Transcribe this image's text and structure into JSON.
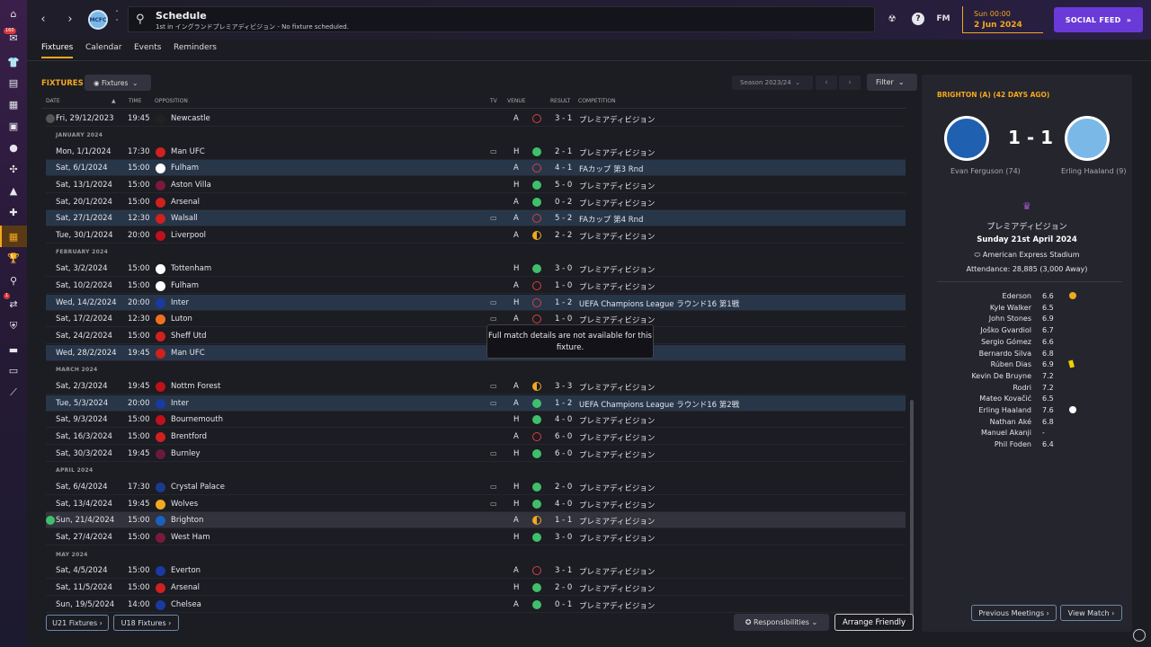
{
  "header": {
    "title": "Schedule",
    "subtitle": "1st in イングランドプレミアディビジョン - No fixture scheduled.",
    "fm_label": "FM",
    "day_time": "Sun 00:00",
    "date": "2 Jun 2024",
    "social_feed": "SOCIAL FEED",
    "badge_count": "160"
  },
  "tabs": [
    "Fixtures",
    "Calendar",
    "Events",
    "Reminders"
  ],
  "fixtures": {
    "title": "FIXTURES",
    "view_select": "Fixtures",
    "season": "Season 2023/24",
    "filter": "Filter",
    "columns": {
      "date": "DATE",
      "time": "TIME",
      "opposition": "OPPOSITION",
      "tv": "TV",
      "venue": "VENUE",
      "result": "RESULT",
      "competition": "COMPETITION"
    },
    "months": [
      "JANUARY 2024",
      "FEBRUARY 2024",
      "MARCH 2024",
      "APRIL 2024",
      "MAY 2024"
    ],
    "rows": [
      {
        "date": "Fri, 29/12/2023",
        "time": "19:45",
        "opp": "Newcastle",
        "venue": "A",
        "result": "3 - 1",
        "comp": "プレミアディビジョン"
      },
      {
        "date": "Mon, 1/1/2024",
        "time": "17:30",
        "opp": "Man UFC",
        "venue": "H",
        "result": "2 - 1",
        "comp": "プレミアディビジョン"
      },
      {
        "date": "Sat, 6/1/2024",
        "time": "15:00",
        "opp": "Fulham",
        "venue": "A",
        "result": "4 - 1",
        "comp": "FAカップ 第3 Rnd"
      },
      {
        "date": "Sat, 13/1/2024",
        "time": "15:00",
        "opp": "Aston Villa",
        "venue": "H",
        "result": "5 - 0",
        "comp": "プレミアディビジョン"
      },
      {
        "date": "Sat, 20/1/2024",
        "time": "15:00",
        "opp": "Arsenal",
        "venue": "A",
        "result": "0 - 2",
        "comp": "プレミアディビジョン"
      },
      {
        "date": "Sat, 27/1/2024",
        "time": "12:30",
        "opp": "Walsall",
        "venue": "A",
        "result": "5 - 2",
        "comp": "FAカップ 第4 Rnd"
      },
      {
        "date": "Tue, 30/1/2024",
        "time": "20:00",
        "opp": "Liverpool",
        "venue": "A",
        "result": "2 - 2",
        "comp": "プレミアディビジョン"
      },
      {
        "date": "Sat, 3/2/2024",
        "time": "15:00",
        "opp": "Tottenham",
        "venue": "H",
        "result": "3 - 0",
        "comp": "プレミアディビジョン"
      },
      {
        "date": "Sat, 10/2/2024",
        "time": "15:00",
        "opp": "Fulham",
        "venue": "A",
        "result": "1 - 0",
        "comp": "プレミアディビジョン"
      },
      {
        "date": "Wed, 14/2/2024",
        "time": "20:00",
        "opp": "Inter",
        "venue": "H",
        "result": "1 - 2",
        "comp": "UEFA Champions League ラウンド16 第1戦"
      },
      {
        "date": "Sat, 17/2/2024",
        "time": "12:30",
        "opp": "Luton",
        "venue": "A",
        "result": "1 - 0",
        "comp": "プレミアディビジョン"
      },
      {
        "date": "Sat, 24/2/2024",
        "time": "15:00",
        "opp": "Sheff Utd",
        "venue": "",
        "result": "",
        "comp": ""
      },
      {
        "date": "Wed, 28/2/2024",
        "time": "19:45",
        "opp": "Man UFC",
        "venue": "",
        "result": "",
        "comp": ""
      },
      {
        "date": "Sat, 2/3/2024",
        "time": "19:45",
        "opp": "Nottm Forest",
        "venue": "A",
        "result": "3 - 3",
        "comp": "プレミアディビジョン"
      },
      {
        "date": "Tue, 5/3/2024",
        "time": "20:00",
        "opp": "Inter",
        "venue": "A",
        "result": "1 - 2",
        "comp": "UEFA Champions League ラウンド16 第2戦"
      },
      {
        "date": "Sat, 9/3/2024",
        "time": "15:00",
        "opp": "Bournemouth",
        "venue": "H",
        "result": "4 - 0",
        "comp": "プレミアディビジョン"
      },
      {
        "date": "Sat, 16/3/2024",
        "time": "15:00",
        "opp": "Brentford",
        "venue": "A",
        "result": "6 - 0",
        "comp": "プレミアディビジョン"
      },
      {
        "date": "Sat, 30/3/2024",
        "time": "19:45",
        "opp": "Burnley",
        "venue": "H",
        "result": "6 - 0",
        "comp": "プレミアディビジョン"
      },
      {
        "date": "Sat, 6/4/2024",
        "time": "17:30",
        "opp": "Crystal Palace",
        "venue": "H",
        "result": "2 - 0",
        "comp": "プレミアディビジョン"
      },
      {
        "date": "Sat, 13/4/2024",
        "time": "19:45",
        "opp": "Wolves",
        "venue": "H",
        "result": "4 - 0",
        "comp": "プレミアディビジョン"
      },
      {
        "date": "Sun, 21/4/2024",
        "time": "15:00",
        "opp": "Brighton",
        "venue": "A",
        "result": "1 - 1",
        "comp": "プレミアディビジョン"
      },
      {
        "date": "Sat, 27/4/2024",
        "time": "15:00",
        "opp": "West Ham",
        "venue": "H",
        "result": "3 - 0",
        "comp": "プレミアディビジョン"
      },
      {
        "date": "Sat, 4/5/2024",
        "time": "15:00",
        "opp": "Everton",
        "venue": "A",
        "result": "3 - 1",
        "comp": "プレミアディビジョン"
      },
      {
        "date": "Sat, 11/5/2024",
        "time": "15:00",
        "opp": "Arsenal",
        "venue": "H",
        "result": "2 - 0",
        "comp": "プレミアディビジョン"
      },
      {
        "date": "Sun, 19/5/2024",
        "time": "14:00",
        "opp": "Chelsea",
        "venue": "A",
        "result": "0 - 1",
        "comp": "プレミアディビジョン"
      }
    ],
    "tooltip": "Full match details are not available for this fixture.",
    "u21": "U21 Fixtures",
    "u18": "U18 Fixtures",
    "responsibilities": "Responsibilities",
    "arrange_friendly": "Arrange Friendly"
  },
  "colors": {
    "win": "#3fbf6a",
    "draw": "#f2a81f",
    "loss": "#d84040",
    "accent": "#f2a81f"
  },
  "match_panel": {
    "title": "BRIGHTON (A) (42 DAYS AGO)",
    "score": "1 - 1",
    "home_scorer": "Evan Ferguson (74)",
    "away_scorer": "Erling Haaland (9)",
    "competition": "プレミアディビジョン",
    "date": "Sunday 21st April 2024",
    "stadium": "American Express Stadium",
    "attendance": "Attendance: 28,885 (3,000 Away)",
    "players": [
      {
        "name": "Ederson",
        "rating": "6.6",
        "icon": "star-icon"
      },
      {
        "name": "Kyle Walker",
        "rating": "6.5",
        "icon": ""
      },
      {
        "name": "John Stones",
        "rating": "6.9",
        "icon": ""
      },
      {
        "name": "Joško Gvardiol",
        "rating": "6.7",
        "icon": ""
      },
      {
        "name": "Sergio Gómez",
        "rating": "6.6",
        "icon": ""
      },
      {
        "name": "Bernardo Silva",
        "rating": "6.8",
        "icon": ""
      },
      {
        "name": "Rúben Dias",
        "rating": "6.9",
        "icon": "yellow-card-icon"
      },
      {
        "name": "Kevin De Bruyne",
        "rating": "7.2",
        "icon": ""
      },
      {
        "name": "Rodri",
        "rating": "7.2",
        "icon": ""
      },
      {
        "name": "Mateo Kovačić",
        "rating": "6.5",
        "icon": ""
      },
      {
        "name": "Erling Haaland",
        "rating": "7.6",
        "icon": "goal-icon"
      },
      {
        "name": "Nathan Aké",
        "rating": "6.8",
        "icon": ""
      },
      {
        "name": "Manuel Akanji",
        "rating": "-",
        "icon": ""
      },
      {
        "name": "Phil Foden",
        "rating": "6.4",
        "icon": ""
      }
    ],
    "previous_meetings": "Previous Meetings",
    "view_match": "View Match"
  }
}
